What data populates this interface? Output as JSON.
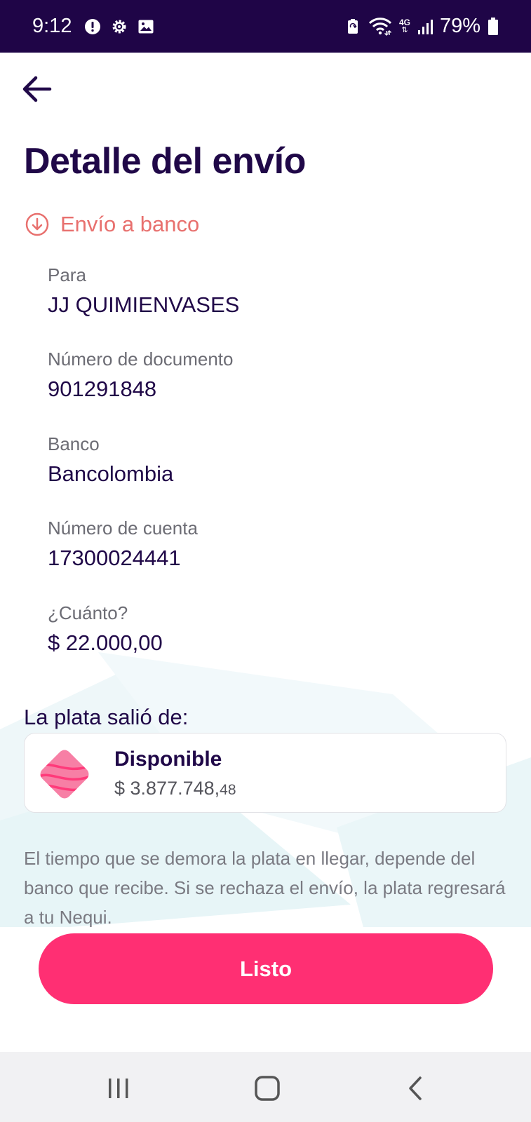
{
  "status_bar": {
    "time": "9:12",
    "battery": "79%",
    "network": "4G",
    "left_icons": [
      "alert-icon",
      "settings-icon",
      "gallery-icon"
    ],
    "right_icons": [
      "battery-saver-icon",
      "wifi-icon",
      "signal-icon",
      "battery-icon"
    ]
  },
  "header": {
    "back_icon": "arrow-left-icon",
    "title": "Detalle del envío"
  },
  "transaction": {
    "type_icon": "circle-arrow-down-icon",
    "type_label": "Envío a banco"
  },
  "details": [
    {
      "label": "Para",
      "value": "JJ QUIMIENVASES"
    },
    {
      "label": "Número de documento",
      "value": "901291848"
    },
    {
      "label": "Banco",
      "value": "Bancolombia"
    },
    {
      "label": "Número de cuenta",
      "value": "17300024441"
    },
    {
      "label": "¿Cuánto?",
      "value": "$ 22.000,00"
    }
  ],
  "source": {
    "heading": "La plata salió de:",
    "name": "Disponible",
    "balance_main": "$ 3.877.748,",
    "balance_cents": "48",
    "icon": "pocket-card-icon"
  },
  "info_text": "El tiempo que se demora la plata en llegar, depende del banco que recibe. Si se rechaza el envío, la plata regresará a tu Nequi.",
  "primary_button": {
    "label": "Listo"
  },
  "navigation": [
    "recent-apps-icon",
    "home-icon",
    "back-icon"
  ],
  "colors": {
    "status_bar": "#1f0547",
    "primary": "#200848",
    "accent": "#ff2f73",
    "type_label": "#e8706e"
  }
}
